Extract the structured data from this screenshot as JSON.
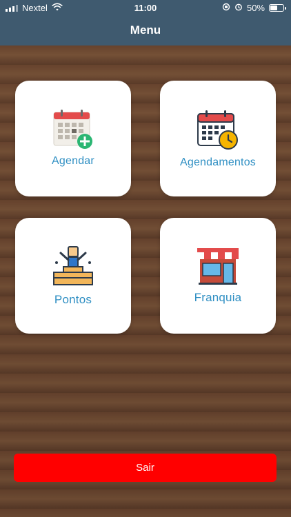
{
  "status_bar": {
    "carrier": "Nextel",
    "time": "11:00",
    "battery": "50%"
  },
  "nav": {
    "title": "Menu"
  },
  "tiles": [
    {
      "label": "Agendar",
      "icon": "calendar-add-icon"
    },
    {
      "label": "Agendamentos",
      "icon": "calendar-clock-icon"
    },
    {
      "label": "Pontos",
      "icon": "podium-winner-icon"
    },
    {
      "label": "Franquia",
      "icon": "storefront-icon"
    }
  ],
  "sair": {
    "label": "Sair",
    "color": "#ff0000"
  },
  "colors": {
    "nav_bg": "#3f5a6f",
    "tile_label": "#2f8fc3"
  }
}
